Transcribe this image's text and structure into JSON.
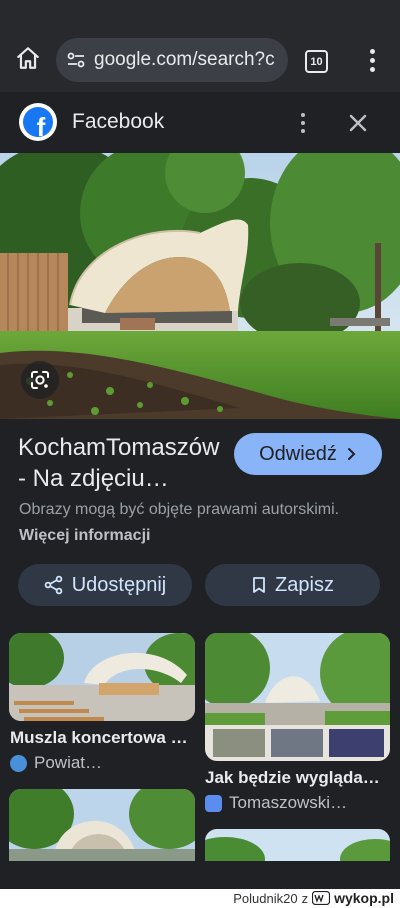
{
  "browser": {
    "url": "google.com/search?c",
    "tab_count": "10"
  },
  "panel": {
    "source_name": "Facebook",
    "title": "KochamTomaszów - Na zdjęciu…",
    "visit_label": "Odwiedź",
    "copyright_text": "Obrazy mogą być objęte prawami autorskimi.",
    "more_info_label": "Więcej informacji",
    "share_label": "Udostępnij",
    "save_label": "Zapisz"
  },
  "related": [
    {
      "title": "Muszla koncertowa …",
      "source": "Powiat…",
      "source_icon_color": "#4a90d9"
    },
    {
      "title": "Jak będzie wygląda…",
      "source": "Tomaszowski…",
      "source_icon_color": "#5b8def"
    }
  ],
  "watermark": {
    "user": "Poludnik20",
    "joiner": "z",
    "site": "wykop.pl"
  },
  "colors": {
    "accent": "#8ab4f8",
    "background": "#202124",
    "tonal_button": "#303846"
  }
}
